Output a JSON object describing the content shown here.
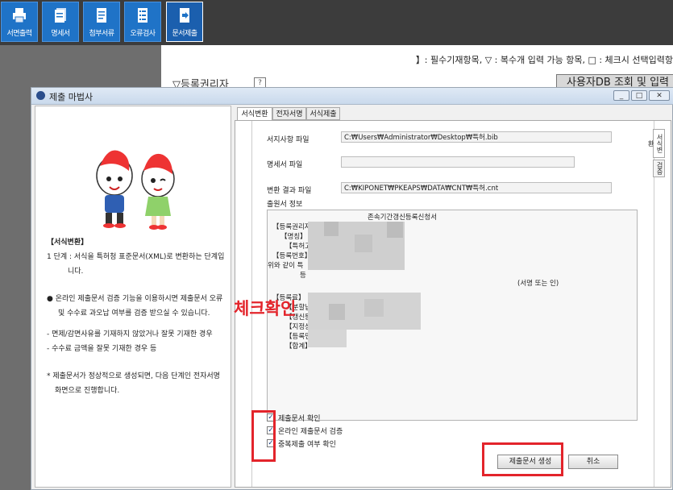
{
  "toolbar": {
    "items": [
      {
        "label": "서면출력",
        "icon": "printer-icon"
      },
      {
        "label": "명세서",
        "icon": "document-icon"
      },
      {
        "label": "첨부서류",
        "icon": "attachment-document-icon"
      },
      {
        "label": "오류검사",
        "icon": "checklist-icon"
      },
      {
        "label": "문서제출",
        "icon": "submit-document-icon"
      }
    ]
  },
  "background_doc": {
    "legend": "】: 필수기재항목,  ▽ : 복수개 입력 가능 항목,  □ : 체크시 선택입력항",
    "section_title": "▽등록권리자",
    "help": "?",
    "db_button": "사용자DB 조회 및 입력"
  },
  "dialog": {
    "title": "제출 마법사",
    "window_buttons": [
      "_",
      "□",
      "✕"
    ],
    "left_panel": {
      "heading": "【서식변환】",
      "step_line1": "1 단계 : 서식을 특허청 표준문서(XML)로 변환하는 단계입",
      "step_line2": "니다.",
      "bullet_line1": "● 온라인 제출문서 검증 기능을 이용하시면 제출문서 오류",
      "bullet_line2": "및 수수료 과오납 여부를 검증 받으실 수 있습니다.",
      "dash1": "- 면제/감면사유를 기재하지 않았거나 잘못 기재한 경우",
      "dash2": "- 수수료 금액을 잘못 기재한 경우 등",
      "note_line1": "* 제출문서가 정상적으로 생성되면, 다음 단계인 전자서명",
      "note_line2": "화면으로 진행합니다."
    },
    "tabs": [
      "서식변환",
      "전자서명",
      "서식제출"
    ],
    "side_tabs": [
      "서식변환",
      "검증"
    ],
    "fields": {
      "source_label": "서지사항 파일",
      "source_value": "C:₩Users₩Administrator₩Desktop₩특허.bib",
      "spec_label": "명세서 파일",
      "spec_value": "",
      "result_label": "변환 결과 파일",
      "result_value": "C:₩KIPONET₩PKEAPS₩DATA₩CNT₩특허.cnt",
      "info_label": "출원서 정보"
    },
    "info": {
      "doc_title": "존속기간갱신등록신청서",
      "l1": "【등록권리자】",
      "l2": "【명칭】",
      "l3": "【특허고",
      "l4": "【등록번호】",
      "l5": "위와 같이 특",
      "l6": "등",
      "sign": "(서명 또는 인)",
      "l7": "【등록료】",
      "l8": "【분할납",
      "l9": "【갱신등",
      "l10": "【지정상",
      "l11": "【등록면",
      "l12": "【합계】"
    },
    "checks": [
      {
        "label": "제출문서 확인",
        "checked": true
      },
      {
        "label": "온라인 제출문서 검증",
        "checked": true
      },
      {
        "label": "중복제출 여부 확인",
        "checked": true
      }
    ],
    "buttons": {
      "create": "제출문서 생성",
      "cancel": "취소"
    }
  },
  "annotation": {
    "text": "체크확인",
    "color": "#e3242b"
  },
  "colors": {
    "toolbar_button": "#1f73c7",
    "highlight": "#e3242b"
  }
}
